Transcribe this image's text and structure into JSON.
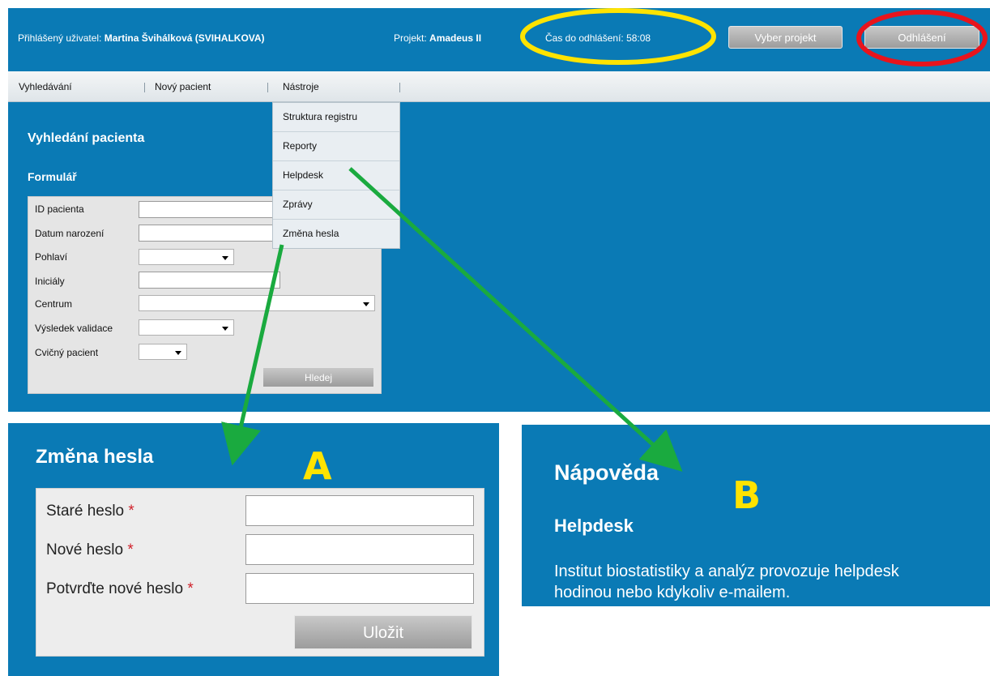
{
  "topbar": {
    "user_label": "Přihlášený uživatel:",
    "user_name": "Martina Švihálková (SVIHALKOVA)",
    "project_label": "Projekt:",
    "project_name": "Amadeus II",
    "timeout_text": "Čas do odhlášení: 58:08",
    "select_project_button": "Vyber projekt",
    "logout_button": "Odhlášení"
  },
  "menu": {
    "items": [
      "Vyhledávání",
      "Nový pacient",
      "Nástroje"
    ]
  },
  "dropdown": {
    "items": [
      "Struktura registru",
      "Reporty",
      "Helpdesk",
      "Zprávy",
      "Změna hesla"
    ]
  },
  "search": {
    "title": "Vyhledání pacienta",
    "form_title": "Formulář",
    "fields": {
      "patient_id": "ID pacienta",
      "birth_date": "Datum narození",
      "gender": "Pohlaví",
      "initials": "Iniciály",
      "center": "Centrum",
      "validation": "Výsledek validace",
      "practice": "Cvičný pacient"
    },
    "search_button": "Hledej"
  },
  "password_change": {
    "label": "A",
    "title": "Změna hesla",
    "old_password": "Staré heslo",
    "new_password": "Nové heslo",
    "confirm_password": "Potvrďte nové heslo",
    "required_marker": "*",
    "save_button": "Uložit"
  },
  "help": {
    "label": "B",
    "title": "Nápověda",
    "subtitle": "Helpdesk",
    "text_line1": "Institut biostatistiky a analýz provozuje helpdesk",
    "text_line2": "hodinou nebo kdykoliv e-mailem."
  },
  "colors": {
    "app_blue": "#0a7ab5",
    "highlight_yellow": "#ffe300",
    "highlight_red": "#e8141c",
    "arrow_green": "#1aaa3f"
  }
}
